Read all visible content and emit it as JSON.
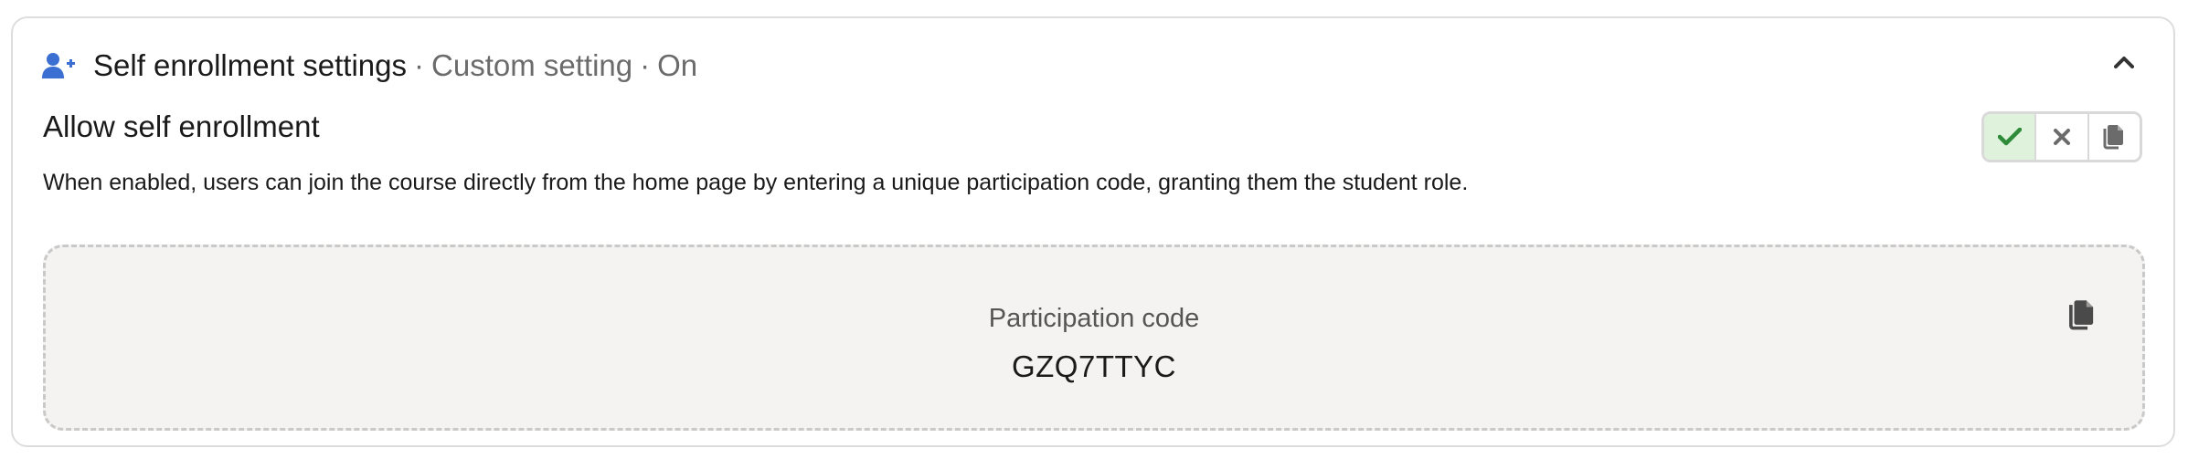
{
  "section": {
    "title": "Self enrollment settings",
    "separator1": "·",
    "setting_type": "Custom setting",
    "separator2": "·",
    "status": "On",
    "icon": "user-plus-icon",
    "accent_color": "#3b6fd1"
  },
  "setting": {
    "title": "Allow self enrollment",
    "description": "When enabled, users can join the course directly from the home page by entering a unique participation code, granting them the student role.",
    "state": "on",
    "controls": [
      {
        "name": "enable",
        "icon": "check-icon",
        "active": true,
        "color": "#2e8b3a"
      },
      {
        "name": "disable",
        "icon": "close-icon",
        "active": false,
        "color": "#6b6b6b"
      },
      {
        "name": "copy",
        "icon": "copy-icon",
        "active": false,
        "color": "#6b6b6b"
      }
    ]
  },
  "participation": {
    "label": "Participation code",
    "code": "GZQ7TTYC",
    "copy_icon": "copy-icon"
  }
}
